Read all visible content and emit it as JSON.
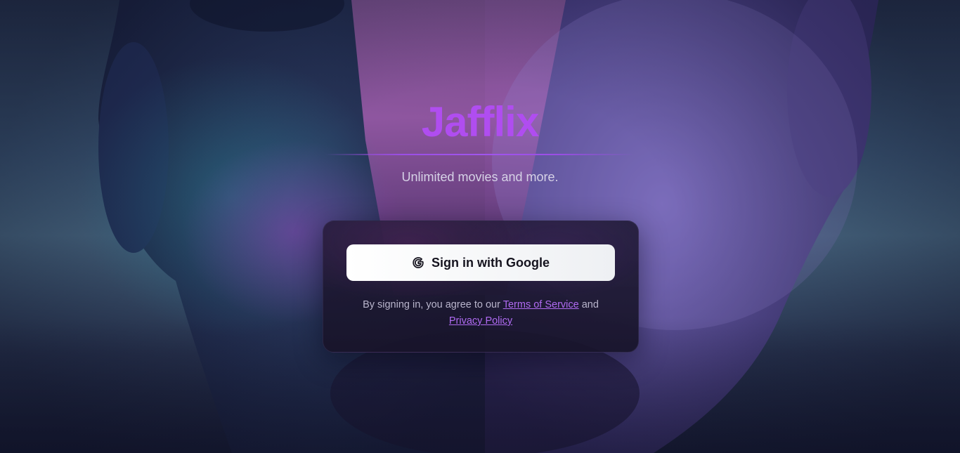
{
  "brand": {
    "title": "Jafflix",
    "tagline": "Unlimited movies and more.",
    "accent_color": "#b04df0"
  },
  "signin": {
    "google_button_label": "Sign in with Google",
    "google_icon": "google-g-icon",
    "legal_prefix": "By signing in, you agree to our",
    "terms_link": "Terms of Service",
    "legal_and": "and",
    "privacy_link": "Privacy Policy",
    "link_color": "#b06bf2"
  }
}
